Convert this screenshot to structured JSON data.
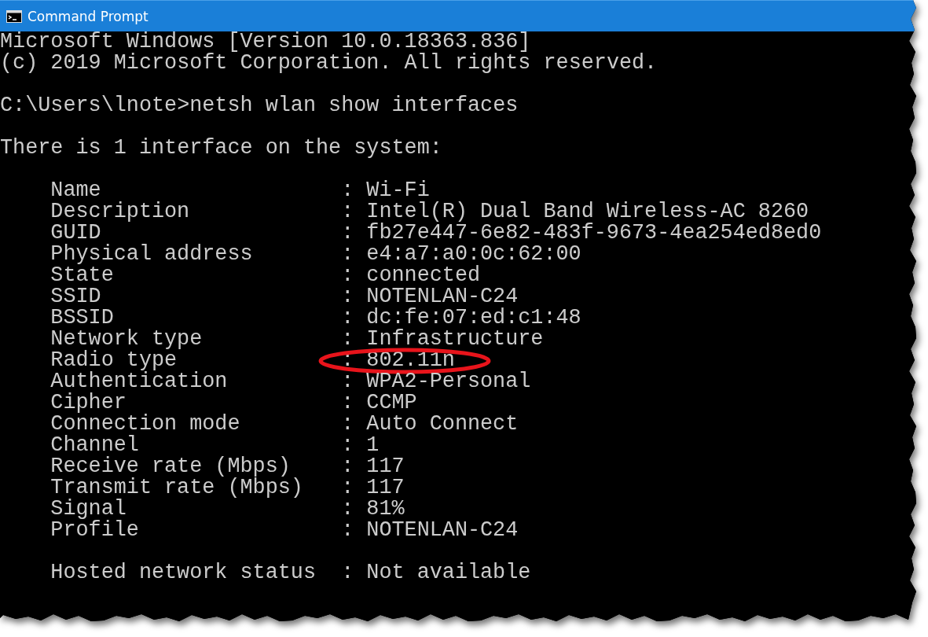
{
  "window": {
    "title": "Command Prompt"
  },
  "console": {
    "header_lines": [
      "Microsoft Windows [Version 10.0.18363.836]",
      "(c) 2019 Microsoft Corporation. All rights reserved."
    ],
    "prompt": "C:\\Users\\lnote>netsh wlan show interfaces",
    "summary": "There is 1 interface on the system:",
    "details": [
      {
        "label": "Name",
        "separator": ":",
        "value": "Wi-Fi",
        "highlighted": false
      },
      {
        "label": "Description",
        "separator": ":",
        "value": "Intel(R) Dual Band Wireless-AC 8260",
        "highlighted": false
      },
      {
        "label": "GUID",
        "separator": ":",
        "value": "fb27e447-6e82-483f-9673-4ea254ed8ed0",
        "highlighted": false
      },
      {
        "label": "Physical address",
        "separator": ":",
        "value": "e4:a7:a0:0c:62:00",
        "highlighted": false
      },
      {
        "label": "State",
        "separator": ":",
        "value": "connected",
        "highlighted": false
      },
      {
        "label": "SSID",
        "separator": ":",
        "value": "NOTENLAN-C24",
        "highlighted": false
      },
      {
        "label": "BSSID",
        "separator": ":",
        "value": "dc:fe:07:ed:c1:48",
        "highlighted": false
      },
      {
        "label": "Network type",
        "separator": ":",
        "value": "Infrastructure",
        "highlighted": false
      },
      {
        "label": "Radio type",
        "separator": ":",
        "value": "802.11n",
        "highlighted": true
      },
      {
        "label": "Authentication",
        "separator": ":",
        "value": "WPA2-Personal",
        "highlighted": false
      },
      {
        "label": "Cipher",
        "separator": ":",
        "value": "CCMP",
        "highlighted": false
      },
      {
        "label": "Connection mode",
        "separator": ":",
        "value": "Auto Connect",
        "highlighted": false
      },
      {
        "label": "Channel",
        "separator": ":",
        "value": "1",
        "highlighted": false
      },
      {
        "label": "Receive rate (Mbps)",
        "separator": ":",
        "value": "117",
        "highlighted": false
      },
      {
        "label": "Transmit rate (Mbps)",
        "separator": ":",
        "value": "117",
        "highlighted": false
      },
      {
        "label": "Signal",
        "separator": ":",
        "value": "81%",
        "highlighted": false
      },
      {
        "label": "Profile",
        "separator": ":",
        "value": "NOTENLAN-C24",
        "highlighted": false
      }
    ],
    "hosted": {
      "label": "Hosted network status",
      "separator": ":",
      "value": "Not available",
      "highlighted": false
    }
  }
}
